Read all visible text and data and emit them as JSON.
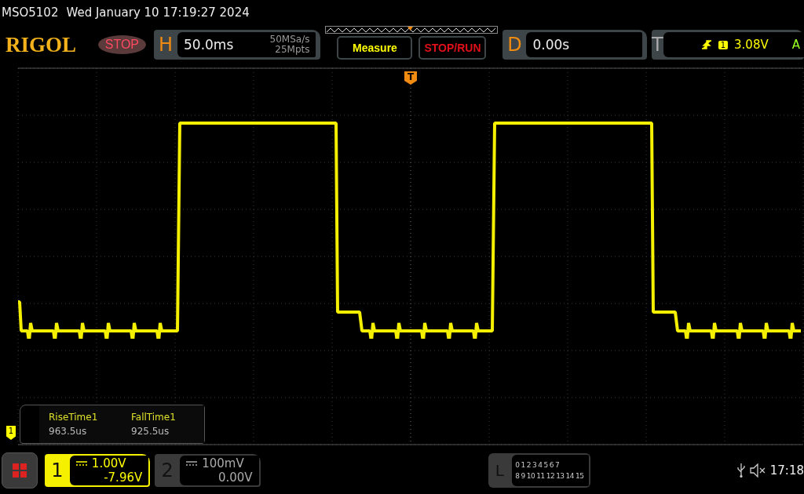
{
  "title_bar": {
    "model": "MSO5102",
    "datetime": "Wed January 10 17:19:27 2024"
  },
  "toolbar": {
    "logo": "RIGOL",
    "run_state": {
      "label": "STOP",
      "running": false
    },
    "horizontal": {
      "label": "H",
      "timebase": "50.0ms",
      "sample_rate": "50MSa/s",
      "memory_depth": "25Mpts"
    },
    "buttons": [
      {
        "label": "Measure",
        "kind": "measure"
      },
      {
        "label": "STOP/RUN",
        "kind": "stoprun"
      }
    ],
    "delay": {
      "label": "D",
      "value": "0.00s"
    },
    "trigger": {
      "label": "T",
      "source": "1",
      "voltage": "3.08V",
      "mode": "A"
    }
  },
  "display": {
    "trigger_marker": "T",
    "ground_marker": "1"
  },
  "measurements": [
    {
      "name": "RiseTime1",
      "value": "963.5us"
    },
    {
      "name": "FallTime1",
      "value": "925.5us"
    }
  ],
  "channels": [
    {
      "number": "1",
      "scale": "1.00V",
      "offset": "-7.96V",
      "selected": true
    },
    {
      "number": "2",
      "scale": "100mV",
      "offset": "0.00V",
      "selected": false
    }
  ],
  "logic": {
    "label": "L",
    "row_1": [
      "0",
      "1",
      "2",
      "3",
      "4",
      "5",
      "6",
      "7"
    ],
    "row_2": [
      "8",
      "9",
      "10",
      "11",
      "12",
      "13",
      "14",
      "15"
    ]
  },
  "status": {
    "time": "17:18"
  }
}
